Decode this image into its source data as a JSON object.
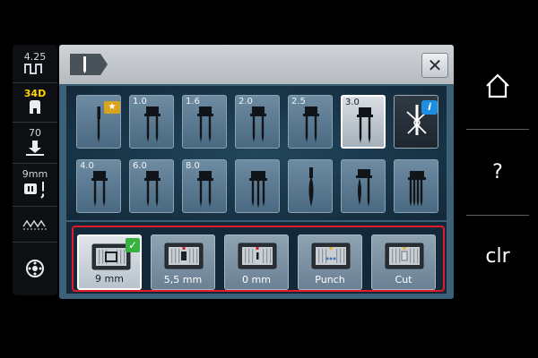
{
  "status_rail": {
    "stitch_width": "4.25",
    "stitch_number": "34D",
    "presser_foot_pressure": "70",
    "needle_size": "9mm"
  },
  "needle_grid": [
    {
      "label": "",
      "icon": "single-needle-icon",
      "badge": "star",
      "state": "normal"
    },
    {
      "label": "1.0",
      "icon": "twin-needle-icon",
      "state": "normal"
    },
    {
      "label": "1.6",
      "icon": "twin-needle-icon",
      "state": "normal"
    },
    {
      "label": "2.0",
      "icon": "twin-needle-icon",
      "state": "normal"
    },
    {
      "label": "2.5",
      "icon": "twin-needle-icon",
      "state": "normal"
    },
    {
      "label": "3.0",
      "icon": "twin-needle-icon",
      "state": "selected"
    },
    {
      "label": "",
      "icon": "needle-threader-icon",
      "badge": "info",
      "state": "dark"
    },
    {
      "label": "4.0",
      "icon": "twin-needle-icon",
      "state": "normal"
    },
    {
      "label": "6.0",
      "icon": "twin-needle-icon",
      "state": "normal"
    },
    {
      "label": "8.0",
      "icon": "twin-needle-icon",
      "state": "normal"
    },
    {
      "label": "",
      "icon": "triple-needle-icon",
      "state": "normal"
    },
    {
      "label": "",
      "icon": "wing-needle-icon",
      "state": "normal"
    },
    {
      "label": "",
      "icon": "double-wing-needle-icon",
      "state": "normal"
    },
    {
      "label": "",
      "icon": "quad-needle-icon",
      "state": "normal"
    }
  ],
  "needle_plates": [
    {
      "label": "9 mm",
      "selected": true
    },
    {
      "label": "5,5 mm",
      "selected": false
    },
    {
      "label": "0 mm",
      "selected": false
    },
    {
      "label": "Punch",
      "selected": false
    },
    {
      "label": "Cut",
      "selected": false
    }
  ],
  "right_panel": {
    "home_label": "⌂",
    "help_label": "?",
    "clear_label": "clr"
  },
  "close_label": "✕",
  "colors": {
    "panel": "#3b6077",
    "tile": "#4a6a82",
    "highlight_frame": "#e01c2a",
    "check": "#37b23f",
    "info_badge": "#1e8ee0",
    "star_badge": "#d7a51d",
    "rail_yellow": "#ffd400"
  }
}
